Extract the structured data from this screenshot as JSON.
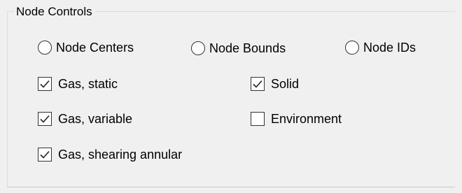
{
  "group": {
    "title": "Node Controls"
  },
  "radios": [
    {
      "label": "Node Centers",
      "selected": false
    },
    {
      "label": "Node Bounds",
      "selected": false
    },
    {
      "label": "Node IDs",
      "selected": false
    }
  ],
  "checkboxes": [
    {
      "label": "Gas, static",
      "checked": true
    },
    {
      "label": "Solid",
      "checked": true
    },
    {
      "label": "Gas, variable",
      "checked": true
    },
    {
      "label": "Environment",
      "checked": false
    },
    {
      "label": "Gas, shearing annular",
      "checked": true
    }
  ]
}
